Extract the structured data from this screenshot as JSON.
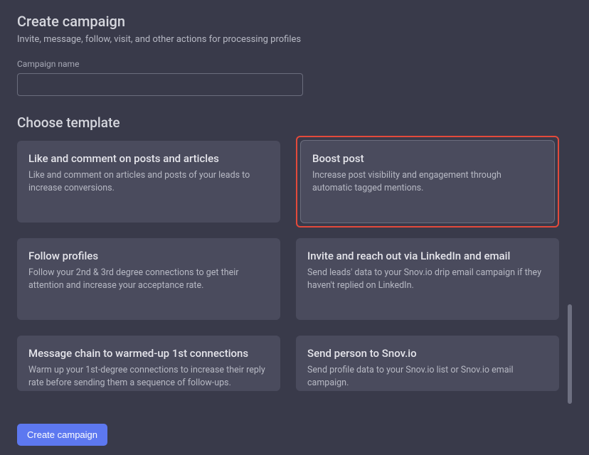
{
  "header": {
    "title": "Create campaign",
    "subtitle": "Invite, message, follow, visit, and other actions for processing profiles"
  },
  "name_field": {
    "label": "Campaign name",
    "value": ""
  },
  "template_section": {
    "title": "Choose template"
  },
  "templates": [
    {
      "title": "Like and comment on posts and articles",
      "desc": "Like and comment on articles and posts of your leads to increase conversions.",
      "selected": false
    },
    {
      "title": "Boost post",
      "desc": "Increase post visibility and engagement through automatic tagged mentions.",
      "selected": true
    },
    {
      "title": "Follow profiles",
      "desc": "Follow your 2nd & 3rd degree connections to get their attention and increase your acceptance rate.",
      "selected": false
    },
    {
      "title": "Invite and reach out via LinkedIn and email",
      "desc": "Send leads' data to your Snov.io drip email campaign if they haven't replied on LinkedIn.",
      "selected": false
    },
    {
      "title": "Message chain to warmed-up 1st connections",
      "desc": "Warm up your 1st-degree connections to increase their reply rate before sending them a sequence of follow-ups.",
      "selected": false
    },
    {
      "title": "Send person to Snov.io",
      "desc": "Send profile data to your Snov.io list or Snov.io email campaign.",
      "selected": false
    }
  ],
  "footer": {
    "create_label": "Create campaign"
  }
}
